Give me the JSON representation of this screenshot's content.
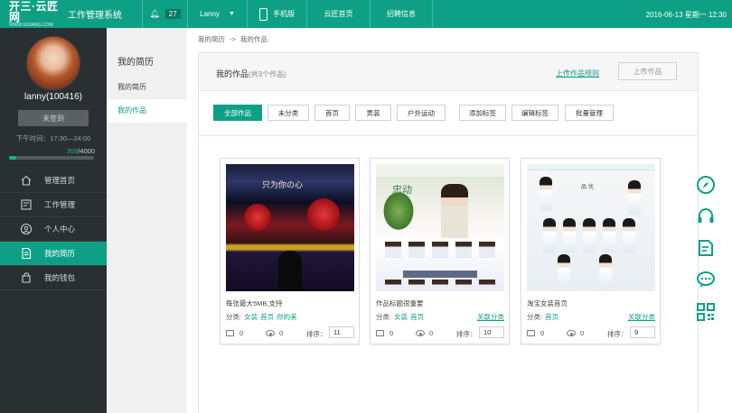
{
  "topbar": {
    "logo_text": "开三·云匠网",
    "logo_sub": "WWW.93JIANG.COM",
    "system_title": "工作管理系统",
    "notification_count": "27",
    "user_name": "Lanny",
    "mobile_label": "手机版",
    "home_label": "云匠首页",
    "jobs_label": "招聘信息",
    "datetime": "2016-06-13 星期一 12:30"
  },
  "profile": {
    "name": "lanny(100416)",
    "checkin_label": "未签到",
    "work_time": "下午时间：17:30—24:00",
    "points_current": "359",
    "points_total": "/4000",
    "points_fraction": 0.09
  },
  "menu": [
    {
      "label": "管理首页",
      "icon": "home-icon"
    },
    {
      "label": "工作管理",
      "icon": "work-icon"
    },
    {
      "label": "个人中心",
      "icon": "user-icon"
    },
    {
      "label": "我的简历",
      "icon": "resume-icon",
      "active": true
    },
    {
      "label": "我的钱包",
      "icon": "wallet-icon"
    }
  ],
  "subnav": {
    "title": "我的简历",
    "items": [
      "我的简历",
      "我的作品"
    ]
  },
  "breadcrumb": {
    "first": "我的简历",
    "separator": "->",
    "second": "我的作品"
  },
  "works": {
    "title": "我的作品",
    "count_text": "(共3个作品)",
    "rules_link": "上传作品规则",
    "upload_button": "上传作品"
  },
  "filters": [
    "全部作品",
    "未分类",
    "首页",
    "男装",
    "户外运动",
    "添加标签",
    "编辑标签",
    "批量管理"
  ],
  "cards": [
    {
      "title": "每张最大5MB,支持",
      "category_label": "分类:",
      "tags": [
        "女装",
        "首页",
        "你的美"
      ],
      "assoc_link": "",
      "comments": "0",
      "views": "0",
      "sort_label": "排序：",
      "sort_value": "11",
      "thumb_text": "只为你の心"
    },
    {
      "title": "作品标题很重要",
      "category_label": "分类:",
      "tags": [
        "女装",
        "首页"
      ],
      "assoc_link": "关联分类",
      "comments": "0",
      "views": "0",
      "sort_label": "排序：",
      "sort_value": "10",
      "thumb_text": "忠动"
    },
    {
      "title": "淘宝女装首页",
      "category_label": "分类:",
      "tags": [
        "首页"
      ],
      "assoc_link": "关联分类",
      "comments": "0",
      "views": "0",
      "sort_label": "排序：",
      "sort_value": "9",
      "thumb_text": "品·优"
    }
  ],
  "float_icons": [
    "compass-icon",
    "headset-icon",
    "edit-note-icon",
    "chat-icon",
    "qrcode-icon"
  ],
  "colors": {
    "accent": "#0ea085",
    "sidebar": "#2a3031"
  }
}
